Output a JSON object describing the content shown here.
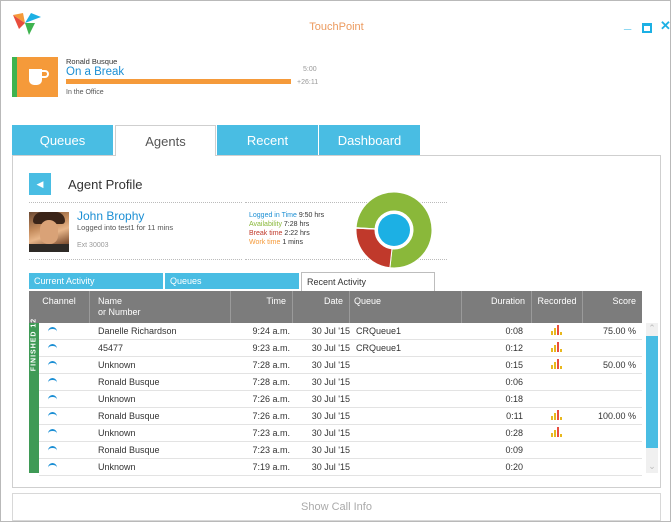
{
  "app": {
    "title": "TouchPoint"
  },
  "window": {
    "minimize": "_",
    "close": "✕"
  },
  "status": {
    "user": "Ronald Busque",
    "state": "On a Break",
    "limit": "5:00",
    "overtime": "+26:11",
    "location": "In the Office",
    "progress": 1.0,
    "colors": {
      "accent": "#f59a3a",
      "indicator": "#3fb34f"
    }
  },
  "tabs": [
    {
      "label": "Queues"
    },
    {
      "label": "Agents"
    },
    {
      "label": "Recent"
    },
    {
      "label": "Dashboard"
    }
  ],
  "profile": {
    "title": "Agent Profile",
    "agent_name": "John Brophy",
    "agent_sub": "Logged into test1 for 11 mins",
    "ext": "Ext 30003",
    "stats": [
      {
        "label": "Logged in Time",
        "value": "9:50 hrs",
        "color": "#1c8fd4"
      },
      {
        "label": "Availability",
        "value": "7:28 hrs",
        "color": "#8ab83a"
      },
      {
        "label": "Break time",
        "value": "2:22 hrs",
        "color": "#c0392b"
      },
      {
        "label": "Work time",
        "value": "1 mins",
        "color": "#f59a3a"
      }
    ],
    "donut": [
      {
        "name": "Availability",
        "value": 7.47,
        "color": "#8ab83a"
      },
      {
        "name": "Break time",
        "value": 2.37,
        "color": "#c0392b"
      },
      {
        "name": "Work time",
        "value": 0.02,
        "color": "#f59a3a"
      }
    ]
  },
  "subtabs": [
    {
      "label": "Current Activity"
    },
    {
      "label": "Queues"
    },
    {
      "label": "Recent Activity"
    }
  ],
  "table": {
    "side_label": "FINISHED 12",
    "headers": {
      "channel": "Channel",
      "name": "Name",
      "name2": "or Number",
      "time": "Time",
      "date": "Date",
      "queue": "Queue",
      "duration": "Duration",
      "recorded": "Recorded",
      "score": "Score"
    },
    "rows": [
      {
        "name": "Danelle Richardson",
        "time": "9:24 a.m.",
        "date": "30 Jul '15",
        "queue": "CRQueue1",
        "duration": "0:08",
        "recorded": true,
        "score": "75.00 %"
      },
      {
        "name": "45477",
        "time": "9:23 a.m.",
        "date": "30 Jul '15",
        "queue": "CRQueue1",
        "duration": "0:12",
        "recorded": true,
        "score": ""
      },
      {
        "name": "Unknown",
        "time": "7:28 a.m.",
        "date": "30 Jul '15",
        "queue": "",
        "duration": "0:15",
        "recorded": true,
        "score": "50.00 %"
      },
      {
        "name": "Ronald Busque",
        "time": "7:28 a.m.",
        "date": "30 Jul '15",
        "queue": "",
        "duration": "0:06",
        "recorded": false,
        "score": ""
      },
      {
        "name": "Unknown",
        "time": "7:26 a.m.",
        "date": "30 Jul '15",
        "queue": "",
        "duration": "0:18",
        "recorded": false,
        "score": ""
      },
      {
        "name": "Ronald Busque",
        "time": "7:26 a.m.",
        "date": "30 Jul '15",
        "queue": "",
        "duration": "0:11",
        "recorded": true,
        "score": "100.00 %"
      },
      {
        "name": "Unknown",
        "time": "7:23 a.m.",
        "date": "30 Jul '15",
        "queue": "",
        "duration": "0:28",
        "recorded": true,
        "score": ""
      },
      {
        "name": "Ronald Busque",
        "time": "7:23 a.m.",
        "date": "30 Jul '15",
        "queue": "",
        "duration": "0:09",
        "recorded": false,
        "score": ""
      },
      {
        "name": "Unknown",
        "time": "7:19 a.m.",
        "date": "30 Jul '15",
        "queue": "",
        "duration": "0:20",
        "recorded": false,
        "score": ""
      }
    ]
  },
  "footer": {
    "show_call_info": "Show Call Info"
  },
  "icons": {
    "logo": "touchpoint-logo-icon",
    "status": "coffee-cup-icon",
    "back": "chevron-left-icon",
    "channel": "phone-icon",
    "recorded": "recording-bars-icon"
  }
}
